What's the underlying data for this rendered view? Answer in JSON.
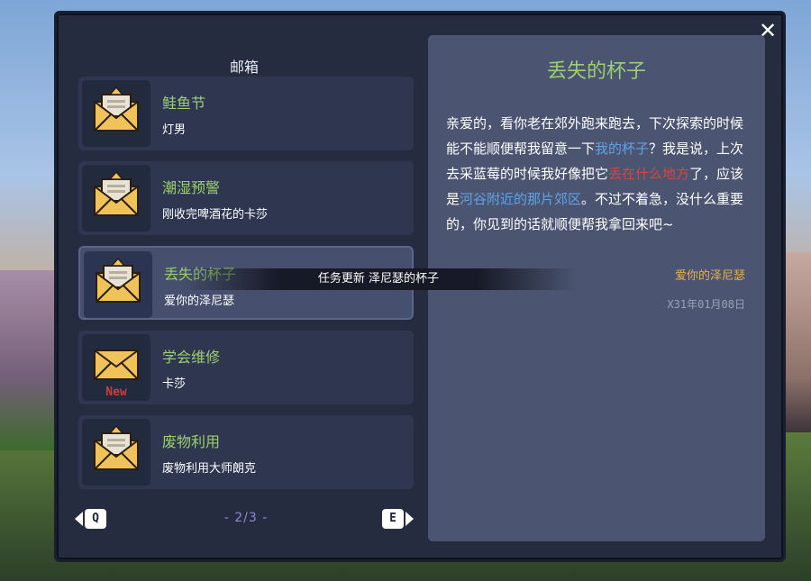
{
  "mailbox": {
    "title": "邮箱",
    "close_icon": "close-icon"
  },
  "mails": [
    {
      "title": "鲑鱼节",
      "sender": "灯男",
      "icon": "open-envelope-icon",
      "is_new": false,
      "selected": false
    },
    {
      "title": "潮湿预警",
      "sender": "刚收完啤酒花的卡莎",
      "icon": "open-envelope-icon",
      "is_new": false,
      "selected": false
    },
    {
      "title": "丢失的杯子",
      "sender": "爱你的泽尼瑟",
      "icon": "open-envelope-icon",
      "is_new": false,
      "selected": true
    },
    {
      "title": "学会维修",
      "sender": "卡莎",
      "icon": "closed-envelope-icon",
      "is_new": true,
      "new_label": "New",
      "selected": false
    },
    {
      "title": "废物利用",
      "sender": "废物利用大师朗克",
      "icon": "open-envelope-icon",
      "is_new": false,
      "selected": false
    }
  ],
  "toast": {
    "text": "任务更新 泽尼瑟的杯子"
  },
  "pager": {
    "prev_key": "Q",
    "next_key": "E",
    "page_text": "- 2/3 -"
  },
  "detail": {
    "title": "丢失的杯子",
    "body_segments": [
      {
        "text": "亲爱的，看你老在郊外跑来跑去，下次探索的时候能不能顺便帮我留意一下",
        "style": "plain"
      },
      {
        "text": "我的杯子",
        "style": "blue"
      },
      {
        "text": "？我是说，上次去采蓝莓的时候我好像把它",
        "style": "plain"
      },
      {
        "text": "丢在什么地方",
        "style": "red"
      },
      {
        "text": "了，应该是",
        "style": "plain"
      },
      {
        "text": "河谷附近的那片郊区",
        "style": "blue"
      },
      {
        "text": "。不过不着急，没什么重要的，你见到的话就顺便帮我拿回来吧~",
        "style": "plain"
      }
    ],
    "signature": "爱你的泽尼瑟",
    "date": "X31年01月08日"
  },
  "colors": {
    "window_bg": "#252c3f",
    "panel_bg": "#4b5571",
    "title_green": "#9ccf6d",
    "link_blue": "#5fa3e6",
    "alert_red": "#d8453f",
    "signature_gold": "#e3b04a",
    "page_purple": "#8e86d9"
  }
}
